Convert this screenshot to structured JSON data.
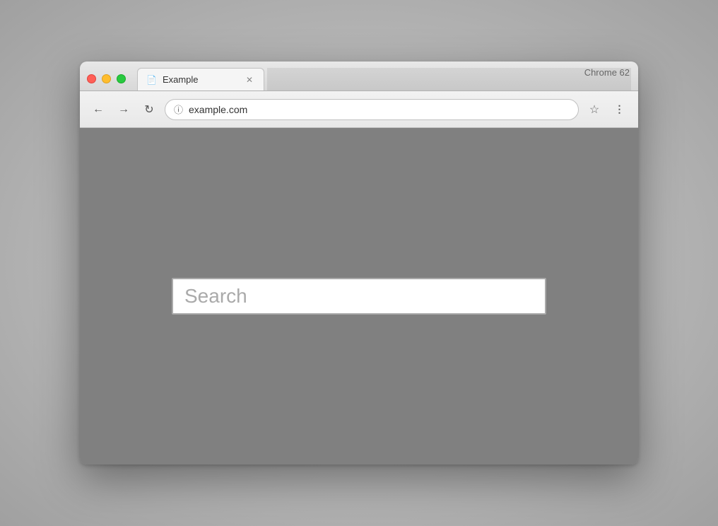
{
  "browser": {
    "chrome_label": "Chrome 62",
    "tab": {
      "title": "Example",
      "icon": "📄"
    },
    "controls": {
      "close": "close",
      "minimize": "minimize",
      "maximize": "maximize"
    },
    "toolbar": {
      "back_label": "←",
      "forward_label": "→",
      "reload_label": "↻",
      "address": "example.com",
      "address_icon": "ⓘ",
      "star_icon": "☆",
      "menu_icon": "⋮"
    }
  },
  "page": {
    "search_placeholder": "Search",
    "background_color": "#808080"
  }
}
